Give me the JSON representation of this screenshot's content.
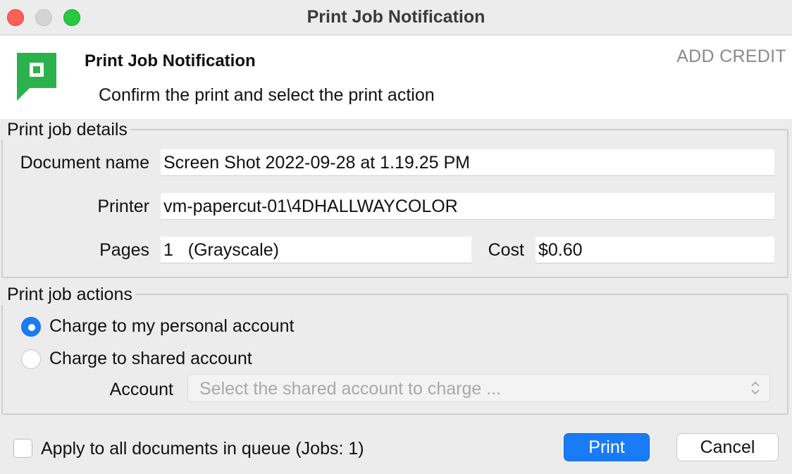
{
  "window": {
    "title": "Print Job Notification",
    "traffic_lights": [
      "close",
      "minimize",
      "zoom"
    ]
  },
  "header": {
    "logo_icon": "papercut-logo-icon",
    "title": "Print Job Notification",
    "subtitle": "Confirm the print and select the print action",
    "add_credit_label": "ADD CREDIT"
  },
  "details": {
    "legend": "Print job details",
    "document_name_label": "Document name",
    "document_name_value": "Screen Shot 2022-09-28 at 1.19.25 PM",
    "printer_label": "Printer",
    "printer_value": "vm-papercut-01\\4DHALLWAYCOLOR",
    "pages_label": "Pages",
    "pages_value": "1   (Grayscale)",
    "cost_label": "Cost",
    "cost_value": "$0.60"
  },
  "actions": {
    "legend": "Print job actions",
    "options": [
      {
        "label": "Charge to my personal account",
        "checked": true
      },
      {
        "label": "Charge to shared account",
        "checked": false
      }
    ],
    "account_label": "Account",
    "account_placeholder": "Select the shared account to charge ..."
  },
  "footer": {
    "apply_all_label": "Apply to all documents in queue (Jobs: 1)",
    "apply_all_checked": false,
    "print_label": "Print",
    "cancel_label": "Cancel"
  },
  "colors": {
    "accent": "#1a7bf6",
    "logo_green": "#2bb24c",
    "close": "#fe5f57",
    "zoom": "#28c840"
  }
}
